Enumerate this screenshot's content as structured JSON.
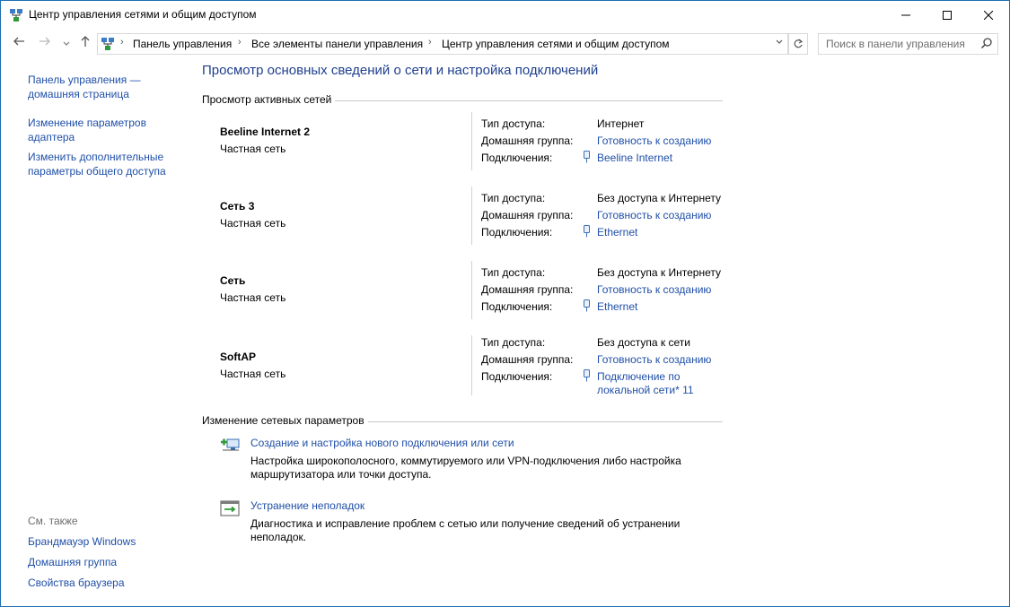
{
  "window": {
    "title": "Центр управления сетями и общим доступом",
    "buttons": {
      "minimize": "—",
      "maximize": "☐",
      "close": "✕"
    }
  },
  "nav": {
    "back_icon": "arrow-left-icon",
    "forward_icon": "arrow-right-icon",
    "recent_icon": "chevron-down-icon",
    "up_icon": "arrow-up-icon"
  },
  "address": {
    "crumbs": [
      "Панель управления",
      "Все элементы панели управления",
      "Центр управления сетями и общим доступом"
    ]
  },
  "search": {
    "placeholder": "Поиск в панели управления"
  },
  "sidebar": {
    "home_line1": "Панель управления —",
    "home_line2": "домашняя страница",
    "adapter_line1": "Изменение параметров",
    "adapter_line2": "адаптера",
    "sharing_line1": "Изменить дополнительные",
    "sharing_line2": "параметры общего доступа",
    "see_also": "См. также",
    "see_also_links": [
      "Брандмауэр Windows",
      "Домашняя группа",
      "Свойства браузера"
    ]
  },
  "main": {
    "heading": "Просмотр основных сведений о сети и настройка подключений",
    "active_networks_label": "Просмотр активных сетей",
    "labels": {
      "access": "Тип доступа:",
      "homegroup": "Домашняя группа:",
      "connections": "Подключения:"
    },
    "networks": [
      {
        "name": "Beeline Internet 2",
        "type": "Частная сеть",
        "access": "Интернет",
        "homegroup": "Готовность к созданию",
        "connection": "Beeline Internet",
        "connection2": ""
      },
      {
        "name": "Сеть  3",
        "type": "Частная сеть",
        "access": "Без доступа к Интернету",
        "homegroup": "Готовность к созданию",
        "connection": "Ethernet",
        "connection2": ""
      },
      {
        "name": "Сеть",
        "type": "Частная сеть",
        "access": "Без доступа к Интернету",
        "homegroup": "Готовность к созданию",
        "connection": "Ethernet",
        "connection2": ""
      },
      {
        "name": "SoftAP",
        "type": "Частная сеть",
        "access": "Без доступа к сети",
        "homegroup": "Готовность к созданию",
        "connection": "Подключение по",
        "connection2": "локальной сети* 11"
      }
    ],
    "change_label": "Изменение сетевых параметров",
    "tasks": [
      {
        "title": "Создание и настройка нового подключения или сети",
        "desc": "Настройка широкополосного, коммутируемого или VPN-подключения либо настройка маршрутизатора или точки доступа."
      },
      {
        "title": "Устранение неполадок",
        "desc": "Диагностика и исправление проблем с сетью или получение сведений об устранении неполадок."
      }
    ]
  },
  "colors": {
    "link": "#1f4fa8",
    "heading": "#1e3f8f",
    "border": "#1e6fb0"
  }
}
